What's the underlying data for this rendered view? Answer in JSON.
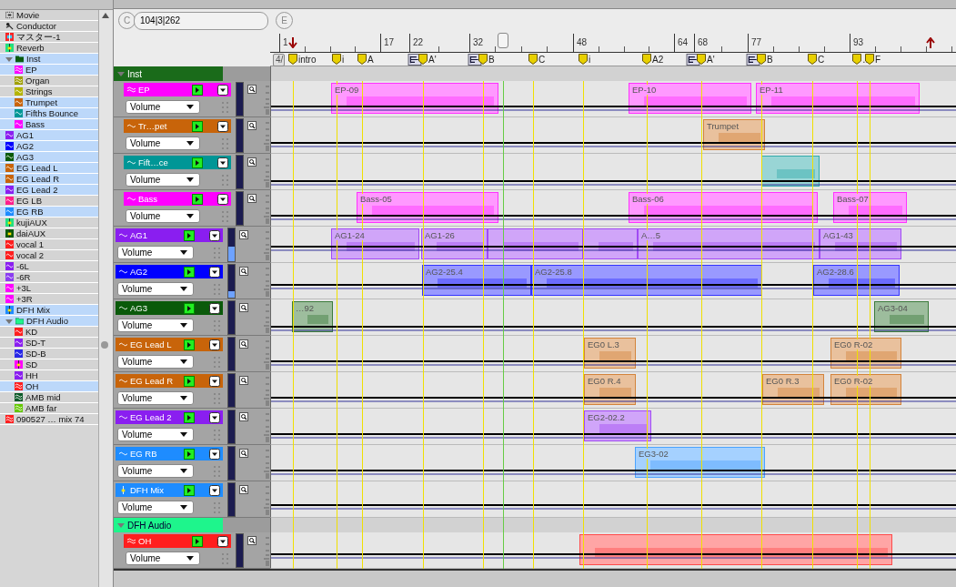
{
  "sidebar": {
    "items": [
      {
        "name": "Movie",
        "kind": "movie",
        "selected": false
      },
      {
        "name": "Conductor",
        "kind": "conductor",
        "selected": false
      },
      {
        "name": "マスター-1",
        "kind": "master",
        "color": "#ff2020",
        "selected": false
      },
      {
        "name": "Reverb",
        "kind": "aux",
        "color": "#20e080",
        "selected": false
      },
      {
        "name": "Inst",
        "kind": "folder",
        "color": "#0a5a0a",
        "selected": true,
        "expanded": true,
        "children": [
          {
            "name": "EP",
            "kind": "wave2",
            "color": "#ff00ff",
            "selected": true
          },
          {
            "name": "Organ",
            "kind": "wave2",
            "color": "#a0a000",
            "selected": false
          },
          {
            "name": "Strings",
            "kind": "wave",
            "color": "#b4b400",
            "selected": false
          },
          {
            "name": "Trumpet",
            "kind": "wave",
            "color": "#c8640a",
            "selected": true
          },
          {
            "name": "Fifths Bounce",
            "kind": "wave",
            "color": "#009696",
            "selected": true
          },
          {
            "name": "Bass",
            "kind": "wave",
            "color": "#ff00ff",
            "selected": true
          }
        ]
      },
      {
        "name": "AG1",
        "kind": "wave",
        "color": "#8a1ef0",
        "selected": true
      },
      {
        "name": "AG2",
        "kind": "wave",
        "color": "#0000ff",
        "selected": true
      },
      {
        "name": "AG3",
        "kind": "wave",
        "color": "#0a5a0a",
        "selected": true
      },
      {
        "name": "EG Lead L",
        "kind": "wave",
        "color": "#c8640a",
        "selected": true
      },
      {
        "name": "EG Lead R",
        "kind": "wave",
        "color": "#c8640a",
        "selected": true
      },
      {
        "name": "EG Lead 2",
        "kind": "wave",
        "color": "#8a1ef0",
        "selected": true
      },
      {
        "name": "EG LB",
        "kind": "wave",
        "color": "#ff1e8c",
        "selected": false
      },
      {
        "name": "EG RB",
        "kind": "wave",
        "color": "#1e8cff",
        "selected": true
      },
      {
        "name": "kujiAUX",
        "kind": "aux",
        "color": "#20e080",
        "selected": false
      },
      {
        "name": "daiAUX",
        "kind": "aux",
        "color": "#0a5a0a",
        "selected": false
      },
      {
        "name": "vocal 1",
        "kind": "wave",
        "color": "#ff1e1e",
        "selected": false
      },
      {
        "name": "vocal 2",
        "kind": "wave",
        "color": "#ff1e1e",
        "selected": false
      },
      {
        "name": "-6L",
        "kind": "wave",
        "color": "#8a1ef0",
        "selected": false
      },
      {
        "name": "-6R",
        "kind": "wave",
        "color": "#8a3cf0",
        "selected": false
      },
      {
        "name": "+3L",
        "kind": "wave",
        "color": "#ff00ff",
        "selected": false
      },
      {
        "name": "+3R",
        "kind": "wave",
        "color": "#ff00ff",
        "selected": false
      },
      {
        "name": "DFH Mix",
        "kind": "aux",
        "color": "#1e8cff",
        "selected": true
      },
      {
        "name": "DFH Audio",
        "kind": "folder",
        "color": "#1ef58c",
        "selected": true,
        "expanded": true,
        "children": [
          {
            "name": "KD",
            "kind": "wave",
            "color": "#ff1e1e",
            "selected": false
          },
          {
            "name": "SD-T",
            "kind": "wave",
            "color": "#8a1ef0",
            "selected": false
          },
          {
            "name": "SD-B",
            "kind": "wave",
            "color": "#2828e6",
            "selected": false
          },
          {
            "name": "SD",
            "kind": "aux",
            "color": "#ff00ff",
            "selected": false
          },
          {
            "name": "HH",
            "kind": "wave",
            "color": "#8a1ef0",
            "selected": false
          },
          {
            "name": "OH",
            "kind": "wave2",
            "color": "#ff1e1e",
            "selected": true
          },
          {
            "name": "AMB mid",
            "kind": "wave2",
            "color": "#0a5a28",
            "selected": false
          },
          {
            "name": "AMB far",
            "kind": "wave2",
            "color": "#64c800",
            "selected": false
          }
        ]
      },
      {
        "name": "090527 … mix 74",
        "kind": "wave2",
        "color": "#ff1e1e",
        "selected": false
      }
    ]
  },
  "transport": {
    "cycle_button": "C",
    "counter": "104|3|262",
    "end_button": "E"
  },
  "ruler": {
    "bars": [
      "1",
      "17",
      "22",
      "32",
      "48",
      "64",
      "68",
      "77",
      "93"
    ],
    "time_signature": "4/"
  },
  "markers": [
    {
      "name": "intro",
      "signature": false
    },
    {
      "name": "i",
      "signature": false
    },
    {
      "name": "A",
      "signature": false
    },
    {
      "name": "A'",
      "signature": true
    },
    {
      "name": "B",
      "signature": true
    },
    {
      "name": "C",
      "signature": false
    },
    {
      "name": "i",
      "signature": false
    },
    {
      "name": "A2",
      "signature": false
    },
    {
      "name": "A'",
      "signature": true
    },
    {
      "name": "B",
      "signature": true
    },
    {
      "name": "C",
      "signature": false
    },
    {
      "name": "…",
      "signature": false
    },
    {
      "name": "F",
      "signature": false
    }
  ],
  "tracks": [
    {
      "kind": "folder",
      "name": "Inst",
      "color": "#1a6b1a",
      "expanded": true,
      "children": [
        {
          "kind": "wave2",
          "name": "EP",
          "color": "#ff00ff",
          "automation": "Volume",
          "level": 0,
          "regions": [
            {
              "name": "EP-09"
            },
            {
              "name": "EP-10"
            },
            {
              "name": "EP-11"
            }
          ]
        },
        {
          "kind": "wave",
          "name": "Tr…pet",
          "color": "#c8640a",
          "automation": "Volume",
          "level": 0,
          "regions": [
            {
              "name": "Trumpet"
            }
          ]
        },
        {
          "kind": "wave",
          "name": "Fift…ce",
          "color": "#009696",
          "automation": "Volume",
          "level": 0
        },
        {
          "kind": "wave",
          "name": "Bass",
          "color": "#ff00ff",
          "automation": "Volume",
          "level": 0,
          "regions": [
            {
              "name": "Bass-05"
            },
            {
              "name": "Bass-06"
            },
            {
              "name": "Bass-07"
            }
          ]
        }
      ]
    },
    {
      "kind": "wave",
      "name": "AG1",
      "color": "#8a1ef0",
      "automation": "Volume",
      "level": 0.45,
      "regions": [
        {
          "name": "AG1-24"
        },
        {
          "name": "AG1-26"
        },
        {
          "name": "A…5"
        },
        {
          "name": "AG1-43"
        }
      ]
    },
    {
      "kind": "wave",
      "name": "AG2",
      "color": "#0000ff",
      "automation": "Volume",
      "level": 0.2,
      "regions": [
        {
          "name": "AG2-25.4"
        },
        {
          "name": "AG2-25.8"
        },
        {
          "name": "AG2-28.6"
        }
      ]
    },
    {
      "kind": "wave",
      "name": "AG3",
      "color": "#0a5a0a",
      "automation": "Volume",
      "level": 0,
      "regions": [
        {
          "name": "…92"
        },
        {
          "name": "AG3-04"
        }
      ]
    },
    {
      "kind": "wave",
      "name": "EG Lead L",
      "color": "#c8640a",
      "automation": "Volume",
      "level": 0,
      "regions": [
        {
          "name": "EG0 L.3"
        },
        {
          "name": "EG0 R-02"
        }
      ]
    },
    {
      "kind": "wave",
      "name": "EG Lead R",
      "color": "#c8640a",
      "automation": "Volume",
      "level": 0,
      "regions": [
        {
          "name": "EG0 R.4"
        },
        {
          "name": "EG0 R.3"
        },
        {
          "name": "EG0 R-02"
        }
      ]
    },
    {
      "kind": "wave",
      "name": "EG Lead 2",
      "color": "#8a1ef0",
      "automation": "Volume",
      "level": 0,
      "regions": [
        {
          "name": "EG2-02.2"
        }
      ]
    },
    {
      "kind": "wave",
      "name": "EG RB",
      "color": "#1e8cff",
      "automation": "Volume",
      "level": 0,
      "regions": [
        {
          "name": "EG3-02"
        }
      ]
    },
    {
      "kind": "aux",
      "name": "DFH Mix",
      "color": "#1e8cff",
      "automation": "Volume",
      "level": 0
    },
    {
      "kind": "folder",
      "name": "DFH Audio",
      "color": "#1ef58c",
      "expanded": true,
      "children": [
        {
          "kind": "wave2",
          "name": "OH",
          "color": "#ff1e1e",
          "automation": "Volume",
          "level": 0
        }
      ]
    }
  ]
}
